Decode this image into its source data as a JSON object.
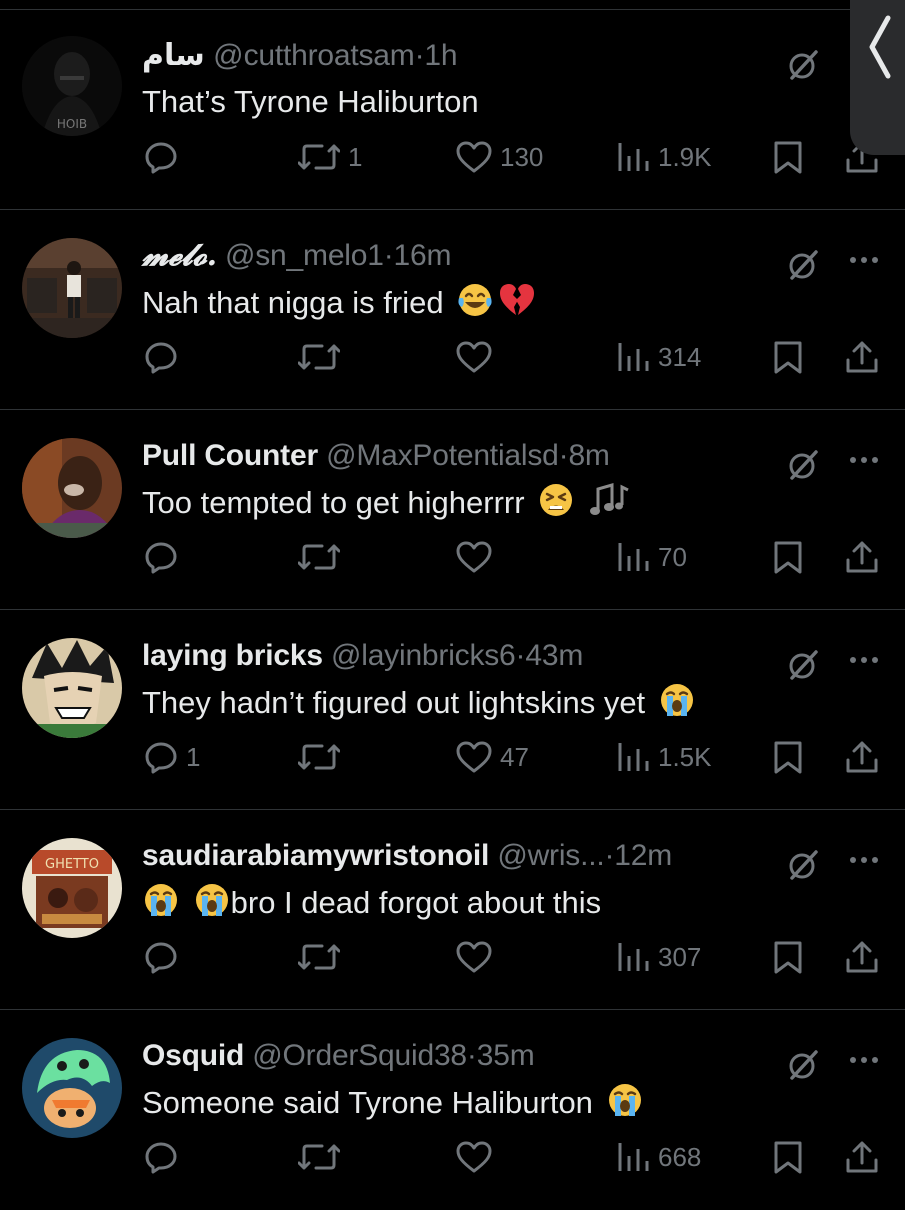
{
  "tweets": [
    {
      "name": "سام",
      "handle": "@cutthroatsam",
      "time": "1h",
      "text": "That’s Tyrone Haliburton",
      "emojis": [],
      "replies": "",
      "retweets": "1",
      "likes": "130",
      "views": "1.9K"
    },
    {
      "name": "𝓶𝓮𝓵𝓸.",
      "handle": "@sn_melo1",
      "time": "16m",
      "text": "Nah that nigga is fried",
      "emojis": [
        "face-with-tears-of-joy",
        "broken-heart"
      ],
      "replies": "",
      "retweets": "",
      "likes": "",
      "views": "314"
    },
    {
      "name": "Pull Counter",
      "handle": "@MaxPotentialsd",
      "time": "8m",
      "text": "Too tempted to get higherrrr",
      "emojis": [
        "tired-face",
        "musical-notes"
      ],
      "replies": "",
      "retweets": "",
      "likes": "",
      "views": "70"
    },
    {
      "name": "laying bricks",
      "handle": "@layinbricks6",
      "time": "43m",
      "text": "They hadn’t figured out lightskins yet",
      "emojis": [
        "loudly-crying-face"
      ],
      "replies": "1",
      "retweets": "",
      "likes": "47",
      "views": "1.5K"
    },
    {
      "name": "saudiarabiamywristonoil",
      "handle": "@wris...",
      "time": "12m",
      "text": "bro I dead forgot about this",
      "emojis": [
        "loudly-crying-face",
        "loudly-crying-face"
      ],
      "replies": "",
      "retweets": "",
      "likes": "",
      "views": "307"
    },
    {
      "name": "Osquid",
      "handle": "@OrderSquid38",
      "time": "35m",
      "text": "Someone said Tyrone Haliburton",
      "emojis": [
        "loudly-crying-face"
      ],
      "replies": "",
      "retweets": "",
      "likes": "",
      "views": "668"
    }
  ],
  "separator": "·",
  "colors": {
    "background": "#000000",
    "text": "#e7e9ea",
    "muted": "#71767b",
    "divider": "#2f3336"
  },
  "icons": [
    "reply-icon",
    "retweet-icon",
    "like-icon",
    "views-icon",
    "bookmark-icon",
    "share-icon",
    "grok-icon",
    "more-icon",
    "back-chevron-icon"
  ]
}
